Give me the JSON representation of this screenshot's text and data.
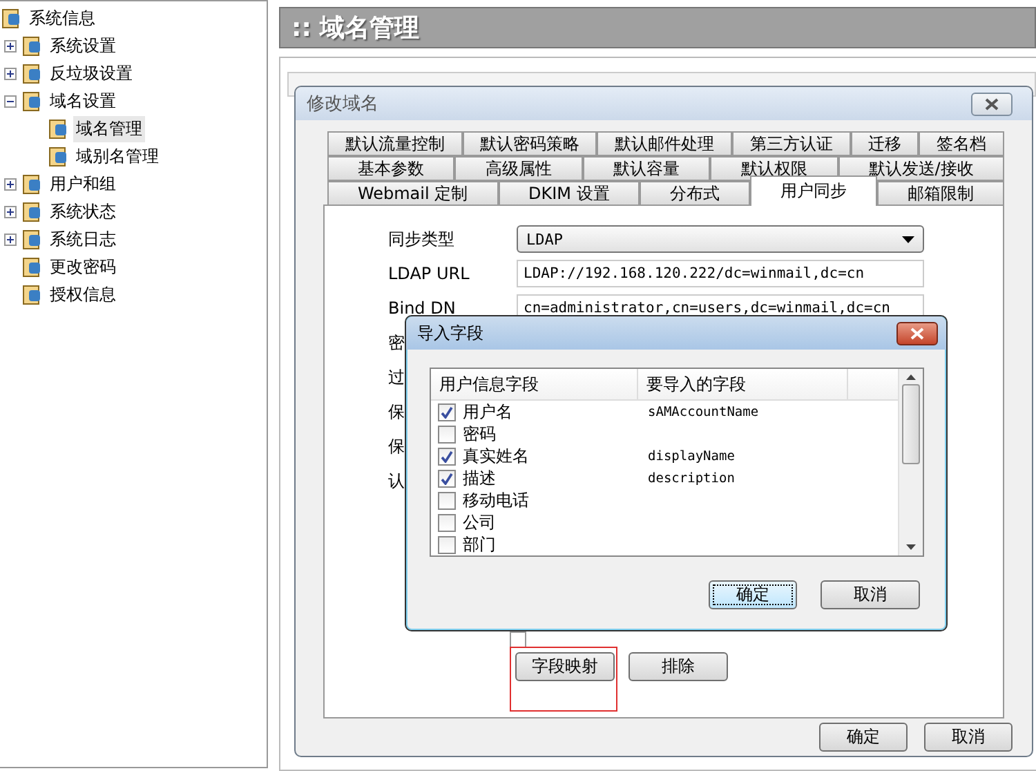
{
  "tree": [
    {
      "label": "系统信息"
    },
    {
      "label": "系统设置",
      "expanded": false
    },
    {
      "label": "反垃圾设置",
      "expanded": false
    },
    {
      "label": "域名设置",
      "expanded": true,
      "children": [
        {
          "label": "域名管理",
          "selected": true
        },
        {
          "label": "域别名管理",
          "selected": false
        }
      ]
    },
    {
      "label": "用户和组",
      "expanded": false
    },
    {
      "label": "系统状态",
      "expanded": false
    },
    {
      "label": "系统日志",
      "expanded": false
    },
    {
      "label": "更改密码"
    },
    {
      "label": "授权信息"
    }
  ],
  "page_title": ":: 域名管理",
  "dialog": {
    "title": "修改域名",
    "tab_rows": [
      [
        {
          "label": "默认流量控制",
          "selected": false
        },
        {
          "label": "默认密码策略",
          "selected": false
        },
        {
          "label": "默认邮件处理",
          "selected": false
        },
        {
          "label": "第三方认证",
          "selected": false
        },
        {
          "label": "迁移",
          "selected": false
        },
        {
          "label": "签名档",
          "selected": false
        }
      ],
      [
        {
          "label": "基本参数",
          "selected": false
        },
        {
          "label": "高级属性",
          "selected": false
        },
        {
          "label": "默认容量",
          "selected": false
        },
        {
          "label": "默认权限",
          "selected": false
        },
        {
          "label": "默认发送/接收",
          "selected": false
        }
      ],
      [
        {
          "label": "Webmail 定制",
          "selected": false
        },
        {
          "label": "DKIM 设置",
          "selected": false
        },
        {
          "label": "分布式",
          "selected": false
        },
        {
          "label": "用户同步",
          "selected": true
        },
        {
          "label": "邮箱限制",
          "selected": false
        }
      ]
    ],
    "fields": [
      {
        "label": "同步类型",
        "kind": "select",
        "value": "LDAP"
      },
      {
        "label": "LDAP URL",
        "kind": "text",
        "value": "LDAP://192.168.120.222/dc=winmail,dc=cn"
      },
      {
        "label": "Bind DN",
        "kind": "text",
        "value": "cn=administrator,cn=users,dc=winmail,dc=cn"
      }
    ],
    "covered_labels": [
      "密",
      "过",
      "保",
      "保",
      "认"
    ],
    "notify_checkbox": {
      "checked": false
    },
    "action_buttons": [
      {
        "label": "字段映射",
        "highlighted": true
      },
      {
        "label": "排除",
        "highlighted": false
      }
    ],
    "buttons": [
      "确定",
      "取消"
    ]
  },
  "import_dialog": {
    "title": "导入字段",
    "columns": [
      "用户信息字段",
      "要导入的字段"
    ],
    "rows": [
      {
        "name": "用户名",
        "checked": true,
        "value": "sAMAccountName"
      },
      {
        "name": "密码",
        "checked": false
      },
      {
        "name": "真实姓名",
        "checked": true,
        "value": "displayName"
      },
      {
        "name": "描述",
        "checked": true,
        "value": "description"
      },
      {
        "name": "移动电话",
        "checked": false
      },
      {
        "name": "公司",
        "checked": false
      },
      {
        "name": "部门",
        "checked": false
      }
    ],
    "buttons": [
      {
        "label": "确定",
        "focused": true
      },
      {
        "label": "取消",
        "focused": false
      }
    ]
  }
}
